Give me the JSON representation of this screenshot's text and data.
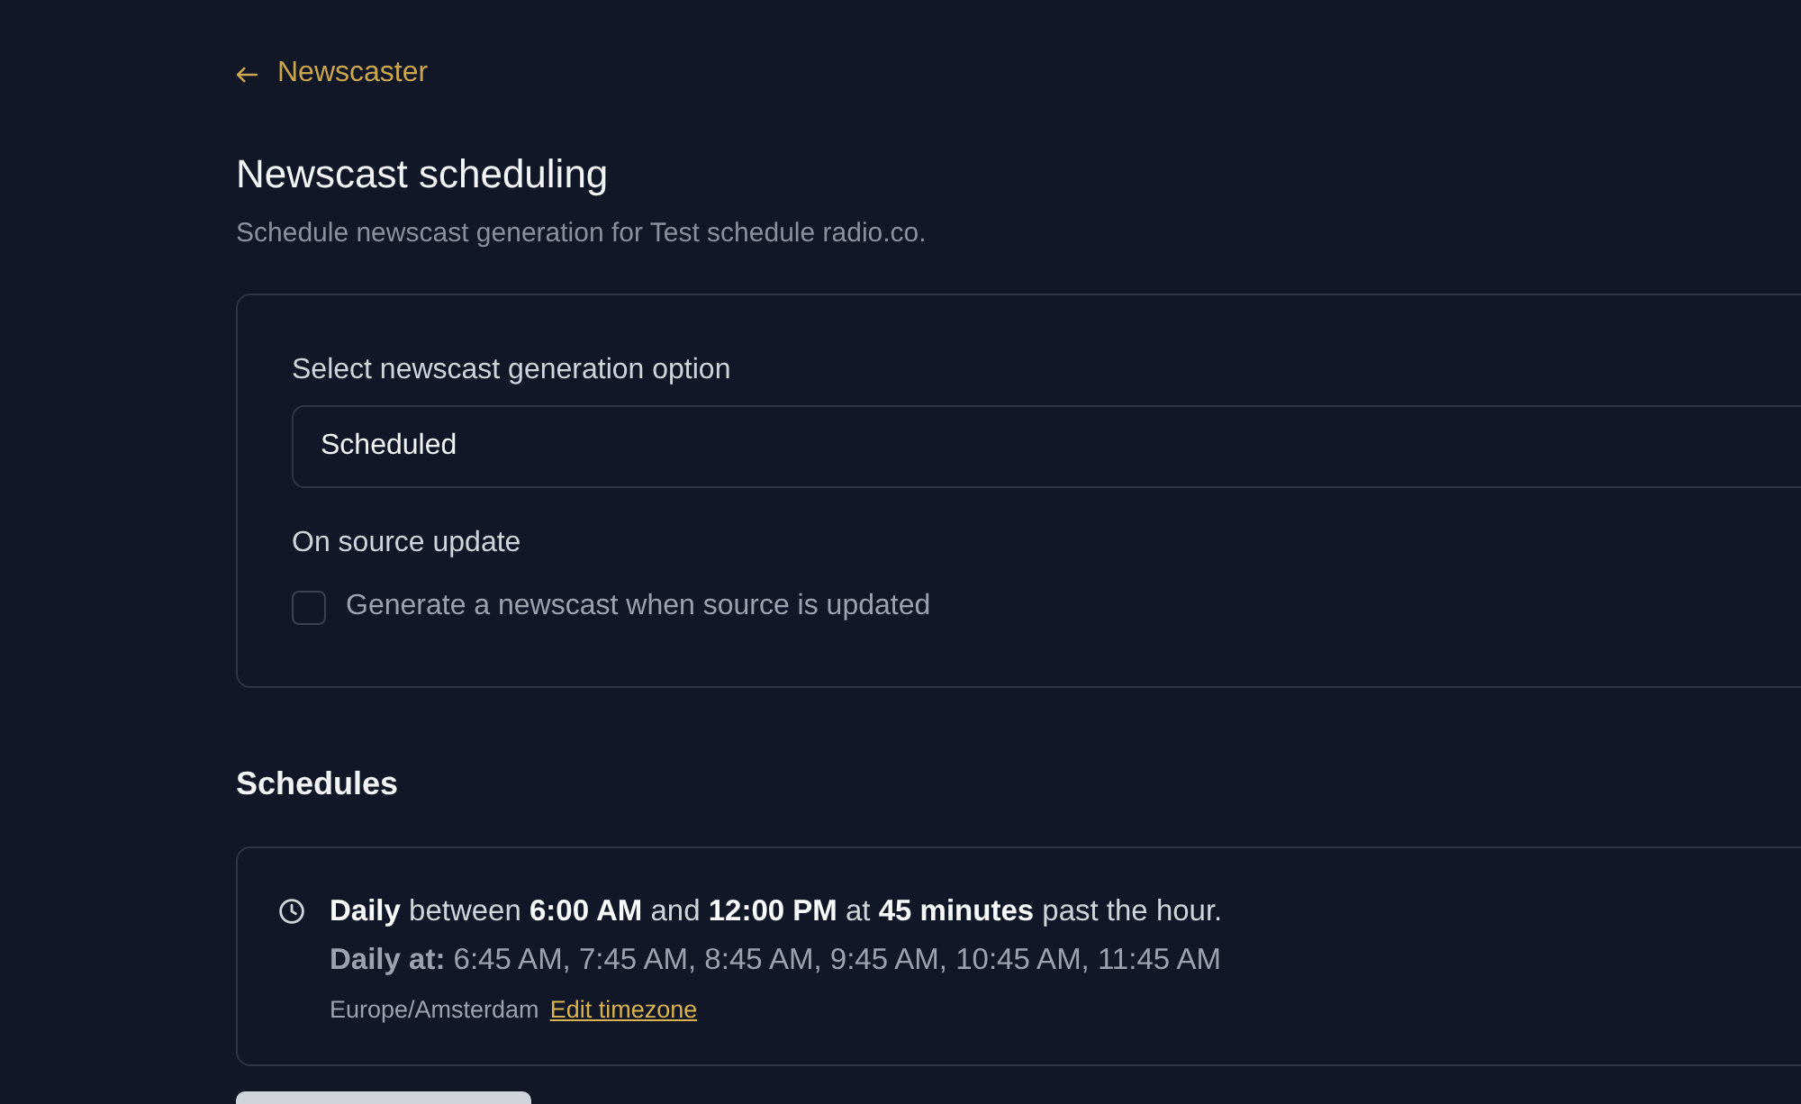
{
  "back_link": {
    "label": "Newscaster"
  },
  "page": {
    "title": "Newscast scheduling",
    "subtitle": "Schedule newscast generation for Test schedule radio.co."
  },
  "generation_settings": {
    "option_label": "Select newscast generation option",
    "option_select": {
      "value": "Scheduled"
    },
    "source_update": {
      "heading": "On source update",
      "checkbox": {
        "label": "Generate a newscast when source is updated",
        "checked": false
      }
    }
  },
  "schedules": {
    "heading": "Schedules",
    "items": [
      {
        "summary": "**Daily** between **6:00 AM** and **12:00 PM** at **45 minutes** past the hour.",
        "times": "**Daily at:** 6:45 AM, 7:45 AM, 8:45 AM, 9:45 AM, 10:45 AM, 11:45 AM",
        "timezone": "Europe/Amsterdam",
        "edit_link": "Edit timezone"
      }
    ]
  }
}
